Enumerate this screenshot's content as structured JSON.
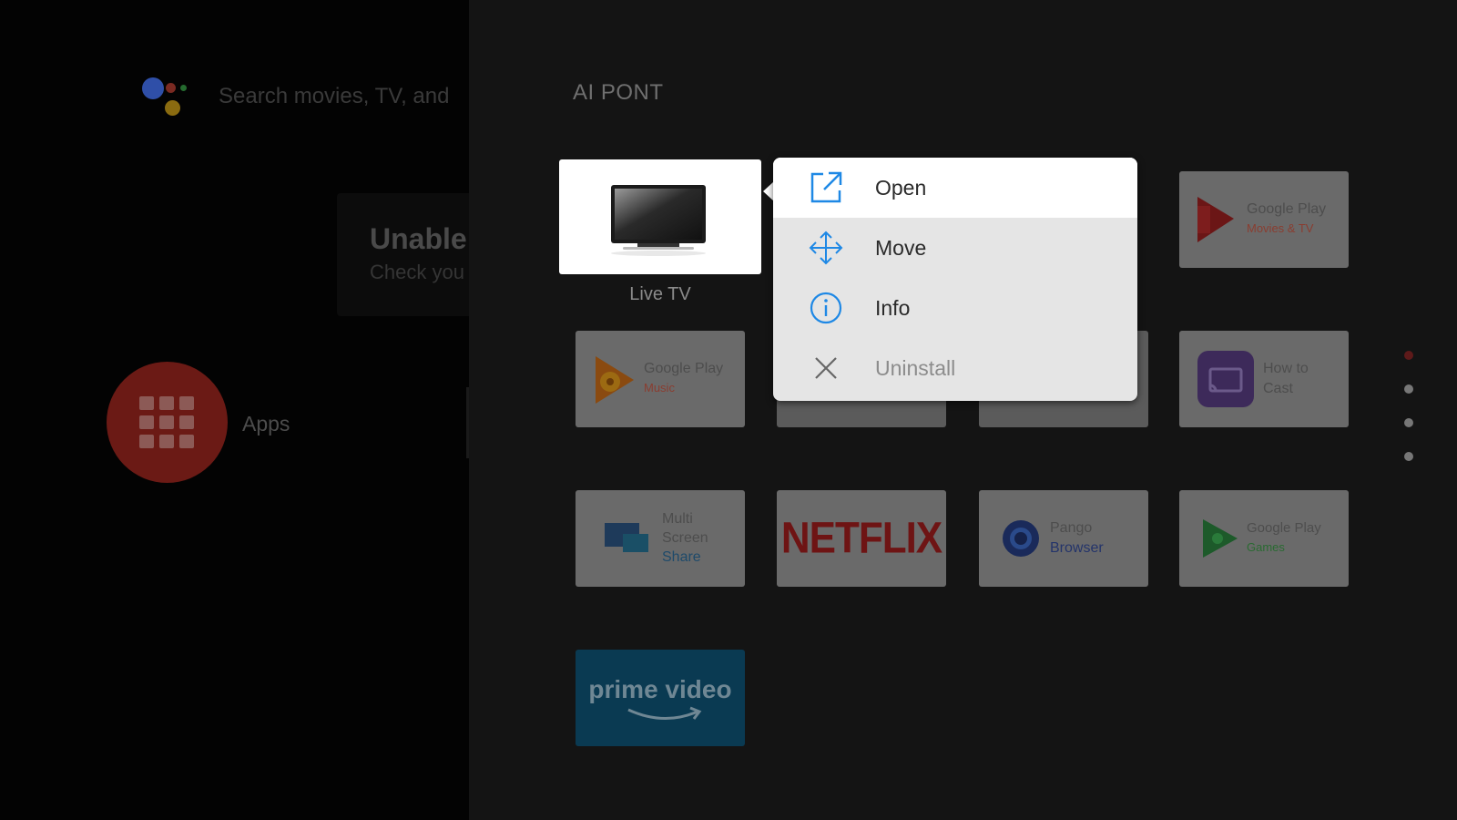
{
  "home": {
    "search_placeholder": "Search movies, TV, and",
    "notice_title": "Unable",
    "notice_subtitle": "Check you",
    "apps_label": "Apps",
    "assistant_colors": [
      "#2f5bc0",
      "#c43a2e",
      "#c9a21a",
      "#2f8a3c"
    ]
  },
  "panel": {
    "title": "AI PONT",
    "focused_app": {
      "label": "Live TV",
      "icon": "television-icon"
    },
    "apps": [
      {
        "id": "google-play-movies",
        "line1": "Google Play",
        "line2": "Movies & TV",
        "icon": "play-movies-icon"
      },
      {
        "id": "google-play-music",
        "line1": "Google Play",
        "line2": "Music",
        "icon": "play-music-icon"
      },
      {
        "id": "how-to-cast",
        "line1": "How to",
        "line2": "Cast",
        "icon": "cast-icon"
      },
      {
        "id": "multi-screen-share",
        "line1": "Multi",
        "line2": "Screen",
        "line3": "Share",
        "icon": "screens-icon"
      },
      {
        "id": "netflix",
        "text": "NETFLIX",
        "icon": "netflix-logo"
      },
      {
        "id": "puffin-browser",
        "line1": "Pango",
        "line2": "Browser",
        "icon": "browser-icon"
      },
      {
        "id": "google-play-games",
        "line1": "Google Play",
        "line2": "Games",
        "icon": "play-games-icon"
      },
      {
        "id": "prime-video",
        "text": "prime video",
        "icon": "prime-video-logo"
      }
    ],
    "pager_pages": 4,
    "pager_active_index": 0
  },
  "context_menu": {
    "items": [
      {
        "label": "Open",
        "icon": "open-external-icon",
        "selected": true,
        "enabled": true
      },
      {
        "label": "Move",
        "icon": "move-arrows-icon",
        "selected": false,
        "enabled": true
      },
      {
        "label": "Info",
        "icon": "info-icon",
        "selected": false,
        "enabled": true
      },
      {
        "label": "Uninstall",
        "icon": "close-x-icon",
        "selected": false,
        "enabled": false
      }
    ],
    "accent_color": "#1e88e5"
  }
}
